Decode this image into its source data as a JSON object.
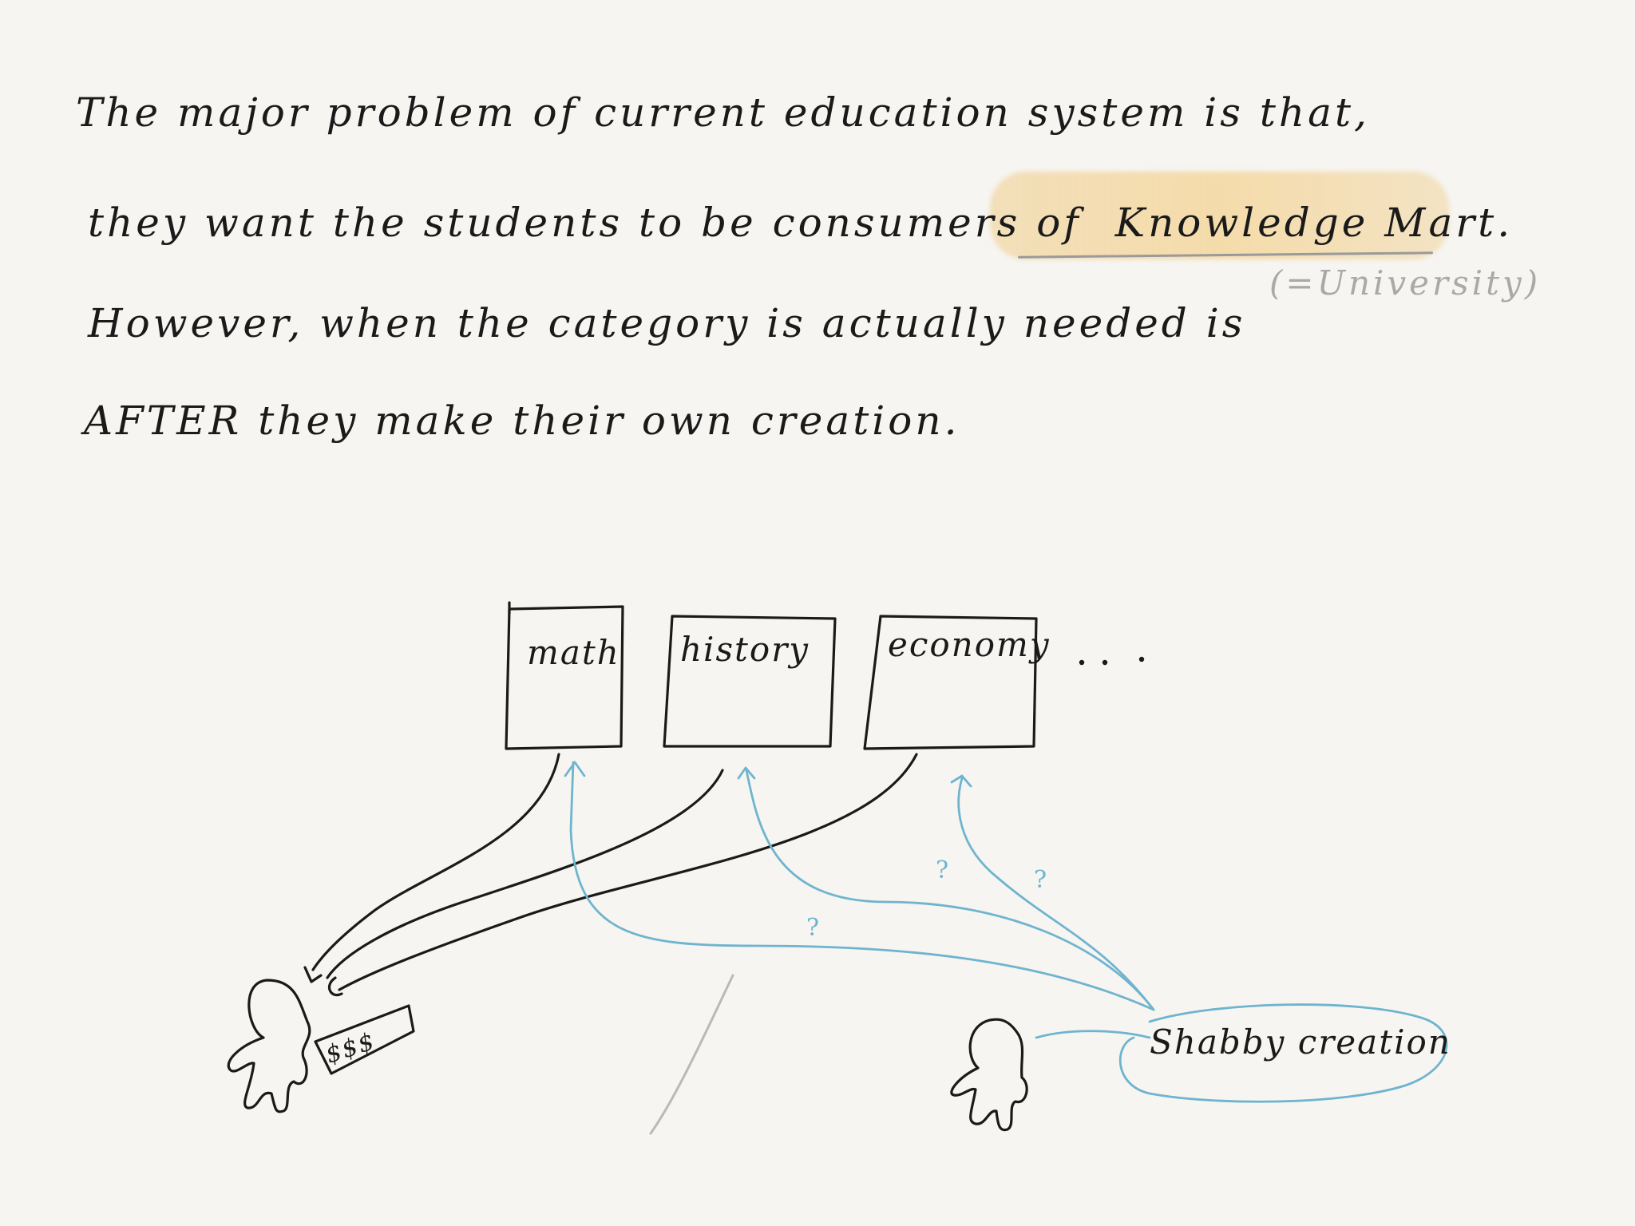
{
  "text_lines": [
    "The major problem of current education system is that,",
    "they want the students to be consumers of",
    "However, when the category is actually needed is",
    "AFTER they make their own creation."
  ],
  "highlighted_phrase": "Knowledge Mart.",
  "annotation": "(=University)",
  "diagram": {
    "categories": [
      "math",
      "history",
      "economy"
    ],
    "more_indicator": "...",
    "money_label": "$$$",
    "creation_label": "Shabby creation",
    "question_mark": "?"
  },
  "colors": {
    "background": "#f6f5f1",
    "ink": "#1a1a1a",
    "highlight": "#f2cf8f",
    "blue_ink": "#6fb4cf",
    "annotation_grey": "#a9a9a9"
  }
}
